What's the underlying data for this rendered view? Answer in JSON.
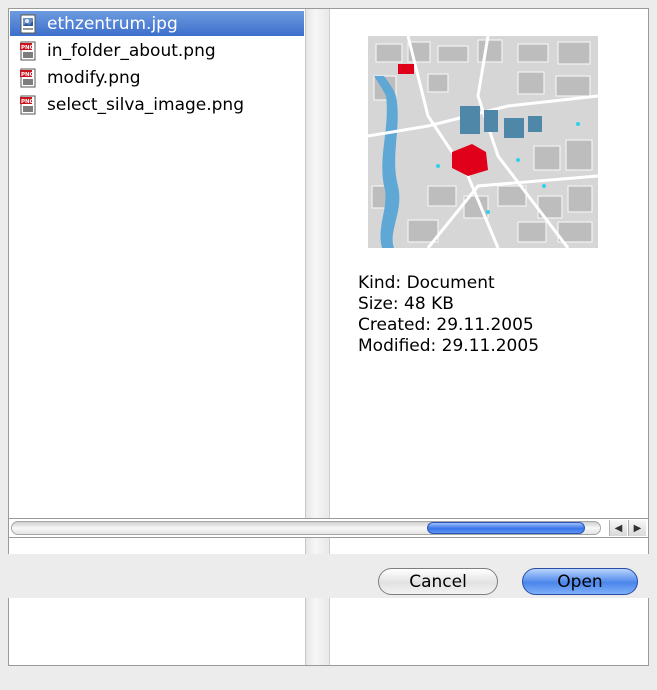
{
  "files": [
    {
      "name": "ethzentrum.jpg",
      "icon": "jpg-file-icon",
      "selected": true
    },
    {
      "name": "in_folder_about.png",
      "icon": "png-file-icon",
      "selected": false
    },
    {
      "name": "modify.png",
      "icon": "png-file-icon",
      "selected": false
    },
    {
      "name": "select_silva_image.png",
      "icon": "png-file-icon",
      "selected": false
    }
  ],
  "preview": {
    "kind": "Kind: Document",
    "size": "Size: 48 KB",
    "created": "Created: 29.11.2005",
    "modified": "Modified: 29.11.2005"
  },
  "scrollbar": {
    "left_arrow": "◀",
    "right_arrow": "▶"
  },
  "buttons": {
    "cancel": "Cancel",
    "open": "Open"
  },
  "colors": {
    "selection": "#3c6fcd",
    "accent_button": "#4b86ea",
    "map_highlight": "#e0001a"
  }
}
